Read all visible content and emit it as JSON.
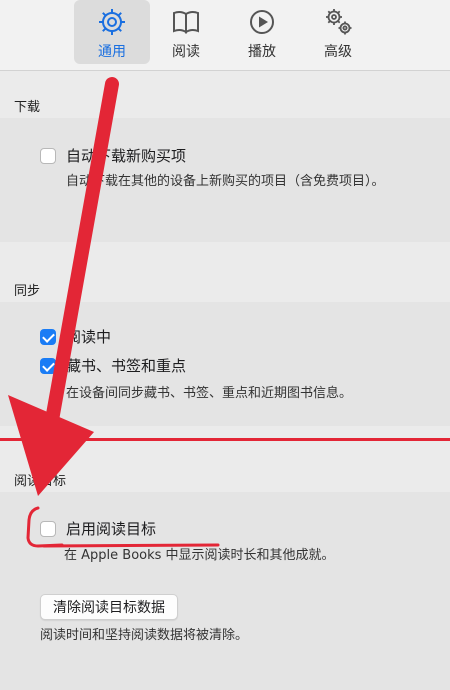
{
  "toolbar": {
    "tabs": [
      {
        "label": "通用",
        "icon": "gear-icon",
        "active": true
      },
      {
        "label": "阅读",
        "icon": "book-icon",
        "active": false
      },
      {
        "label": "播放",
        "icon": "play-icon",
        "active": false
      },
      {
        "label": "高级",
        "icon": "gears-icon",
        "active": false
      }
    ]
  },
  "download": {
    "title": "下载",
    "auto_download_label": "自动下载新购买项",
    "auto_download_checked": false,
    "description": "自动下载在其他的设备上新购买的项目（含免费项目）。"
  },
  "sync": {
    "title": "同步",
    "reading_now_label": "阅读中",
    "reading_now_checked": true,
    "collections_label": "藏书、书签和重点",
    "collections_checked": true,
    "description": "在设备间同步藏书、书签、重点和近期图书信息。"
  },
  "reading_goals": {
    "title": "阅读目标",
    "enable_label": "启用阅读目标",
    "enable_checked": false,
    "description": "在 Apple Books 中显示阅读时长和其他成就。",
    "clear_button": "清除阅读目标数据",
    "clear_description": "阅读时间和坚持阅读数据将被清除。"
  },
  "colors": {
    "accent": "#1a7cf5",
    "annotation_red": "#e32636"
  }
}
